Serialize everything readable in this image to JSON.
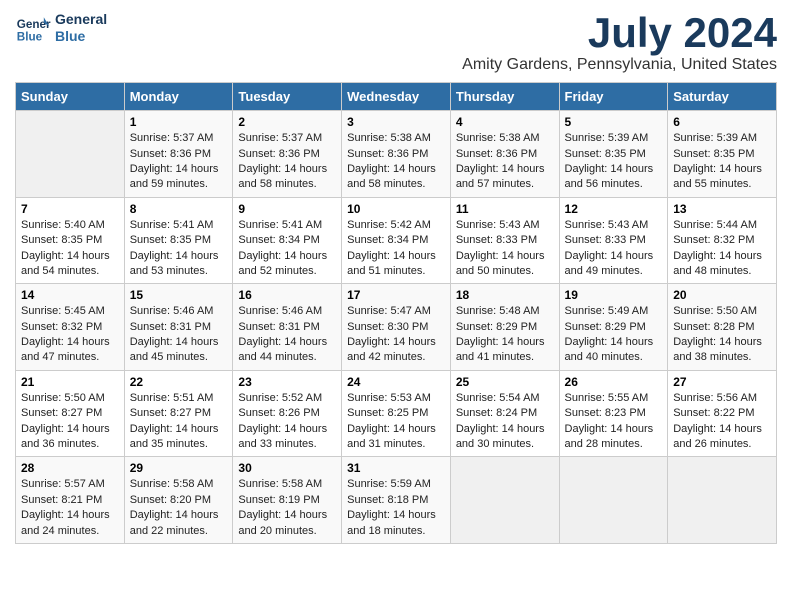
{
  "header": {
    "logo_line1": "General",
    "logo_line2": "Blue",
    "title": "July 2024",
    "subtitle": "Amity Gardens, Pennsylvania, United States"
  },
  "calendar": {
    "headers": [
      "Sunday",
      "Monday",
      "Tuesday",
      "Wednesday",
      "Thursday",
      "Friday",
      "Saturday"
    ],
    "weeks": [
      [
        {
          "day": "",
          "content": ""
        },
        {
          "day": "1",
          "content": "Sunrise: 5:37 AM\nSunset: 8:36 PM\nDaylight: 14 hours and 59 minutes."
        },
        {
          "day": "2",
          "content": "Sunrise: 5:37 AM\nSunset: 8:36 PM\nDaylight: 14 hours and 58 minutes."
        },
        {
          "day": "3",
          "content": "Sunrise: 5:38 AM\nSunset: 8:36 PM\nDaylight: 14 hours and 58 minutes."
        },
        {
          "day": "4",
          "content": "Sunrise: 5:38 AM\nSunset: 8:36 PM\nDaylight: 14 hours and 57 minutes."
        },
        {
          "day": "5",
          "content": "Sunrise: 5:39 AM\nSunset: 8:35 PM\nDaylight: 14 hours and 56 minutes."
        },
        {
          "day": "6",
          "content": "Sunrise: 5:39 AM\nSunset: 8:35 PM\nDaylight: 14 hours and 55 minutes."
        }
      ],
      [
        {
          "day": "7",
          "content": "Sunrise: 5:40 AM\nSunset: 8:35 PM\nDaylight: 14 hours and 54 minutes."
        },
        {
          "day": "8",
          "content": "Sunrise: 5:41 AM\nSunset: 8:35 PM\nDaylight: 14 hours and 53 minutes."
        },
        {
          "day": "9",
          "content": "Sunrise: 5:41 AM\nSunset: 8:34 PM\nDaylight: 14 hours and 52 minutes."
        },
        {
          "day": "10",
          "content": "Sunrise: 5:42 AM\nSunset: 8:34 PM\nDaylight: 14 hours and 51 minutes."
        },
        {
          "day": "11",
          "content": "Sunrise: 5:43 AM\nSunset: 8:33 PM\nDaylight: 14 hours and 50 minutes."
        },
        {
          "day": "12",
          "content": "Sunrise: 5:43 AM\nSunset: 8:33 PM\nDaylight: 14 hours and 49 minutes."
        },
        {
          "day": "13",
          "content": "Sunrise: 5:44 AM\nSunset: 8:32 PM\nDaylight: 14 hours and 48 minutes."
        }
      ],
      [
        {
          "day": "14",
          "content": "Sunrise: 5:45 AM\nSunset: 8:32 PM\nDaylight: 14 hours and 47 minutes."
        },
        {
          "day": "15",
          "content": "Sunrise: 5:46 AM\nSunset: 8:31 PM\nDaylight: 14 hours and 45 minutes."
        },
        {
          "day": "16",
          "content": "Sunrise: 5:46 AM\nSunset: 8:31 PM\nDaylight: 14 hours and 44 minutes."
        },
        {
          "day": "17",
          "content": "Sunrise: 5:47 AM\nSunset: 8:30 PM\nDaylight: 14 hours and 42 minutes."
        },
        {
          "day": "18",
          "content": "Sunrise: 5:48 AM\nSunset: 8:29 PM\nDaylight: 14 hours and 41 minutes."
        },
        {
          "day": "19",
          "content": "Sunrise: 5:49 AM\nSunset: 8:29 PM\nDaylight: 14 hours and 40 minutes."
        },
        {
          "day": "20",
          "content": "Sunrise: 5:50 AM\nSunset: 8:28 PM\nDaylight: 14 hours and 38 minutes."
        }
      ],
      [
        {
          "day": "21",
          "content": "Sunrise: 5:50 AM\nSunset: 8:27 PM\nDaylight: 14 hours and 36 minutes."
        },
        {
          "day": "22",
          "content": "Sunrise: 5:51 AM\nSunset: 8:27 PM\nDaylight: 14 hours and 35 minutes."
        },
        {
          "day": "23",
          "content": "Sunrise: 5:52 AM\nSunset: 8:26 PM\nDaylight: 14 hours and 33 minutes."
        },
        {
          "day": "24",
          "content": "Sunrise: 5:53 AM\nSunset: 8:25 PM\nDaylight: 14 hours and 31 minutes."
        },
        {
          "day": "25",
          "content": "Sunrise: 5:54 AM\nSunset: 8:24 PM\nDaylight: 14 hours and 30 minutes."
        },
        {
          "day": "26",
          "content": "Sunrise: 5:55 AM\nSunset: 8:23 PM\nDaylight: 14 hours and 28 minutes."
        },
        {
          "day": "27",
          "content": "Sunrise: 5:56 AM\nSunset: 8:22 PM\nDaylight: 14 hours and 26 minutes."
        }
      ],
      [
        {
          "day": "28",
          "content": "Sunrise: 5:57 AM\nSunset: 8:21 PM\nDaylight: 14 hours and 24 minutes."
        },
        {
          "day": "29",
          "content": "Sunrise: 5:58 AM\nSunset: 8:20 PM\nDaylight: 14 hours and 22 minutes."
        },
        {
          "day": "30",
          "content": "Sunrise: 5:58 AM\nSunset: 8:19 PM\nDaylight: 14 hours and 20 minutes."
        },
        {
          "day": "31",
          "content": "Sunrise: 5:59 AM\nSunset: 8:18 PM\nDaylight: 14 hours and 18 minutes."
        },
        {
          "day": "",
          "content": ""
        },
        {
          "day": "",
          "content": ""
        },
        {
          "day": "",
          "content": ""
        }
      ]
    ]
  }
}
